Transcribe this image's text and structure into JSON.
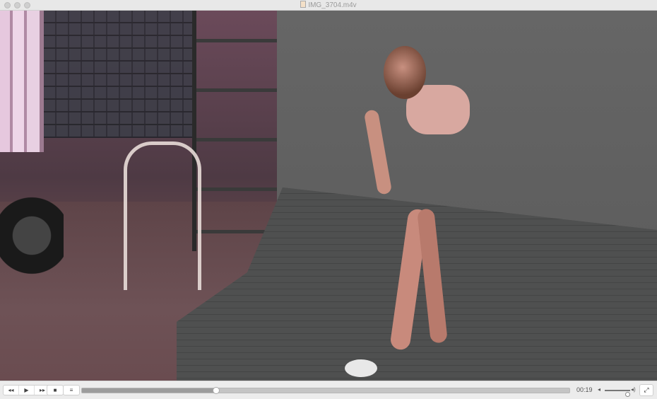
{
  "window": {
    "title": "IMG_3704.m4v",
    "file_icon": "video-file-icon"
  },
  "video": {
    "description_icon": "video-frame"
  },
  "controls": {
    "rewind_icon": "◂◂",
    "play_icon": "▶",
    "fast_forward_icon": "▸▸",
    "stop_icon": "■",
    "playlist_icon": "≡",
    "progress": 0.276,
    "elapsed_time": "00:19",
    "volume_low_icon": "◂",
    "volume_high_icon": "◂)",
    "volume": 0.9,
    "fullscreen_icon": "⤢"
  }
}
